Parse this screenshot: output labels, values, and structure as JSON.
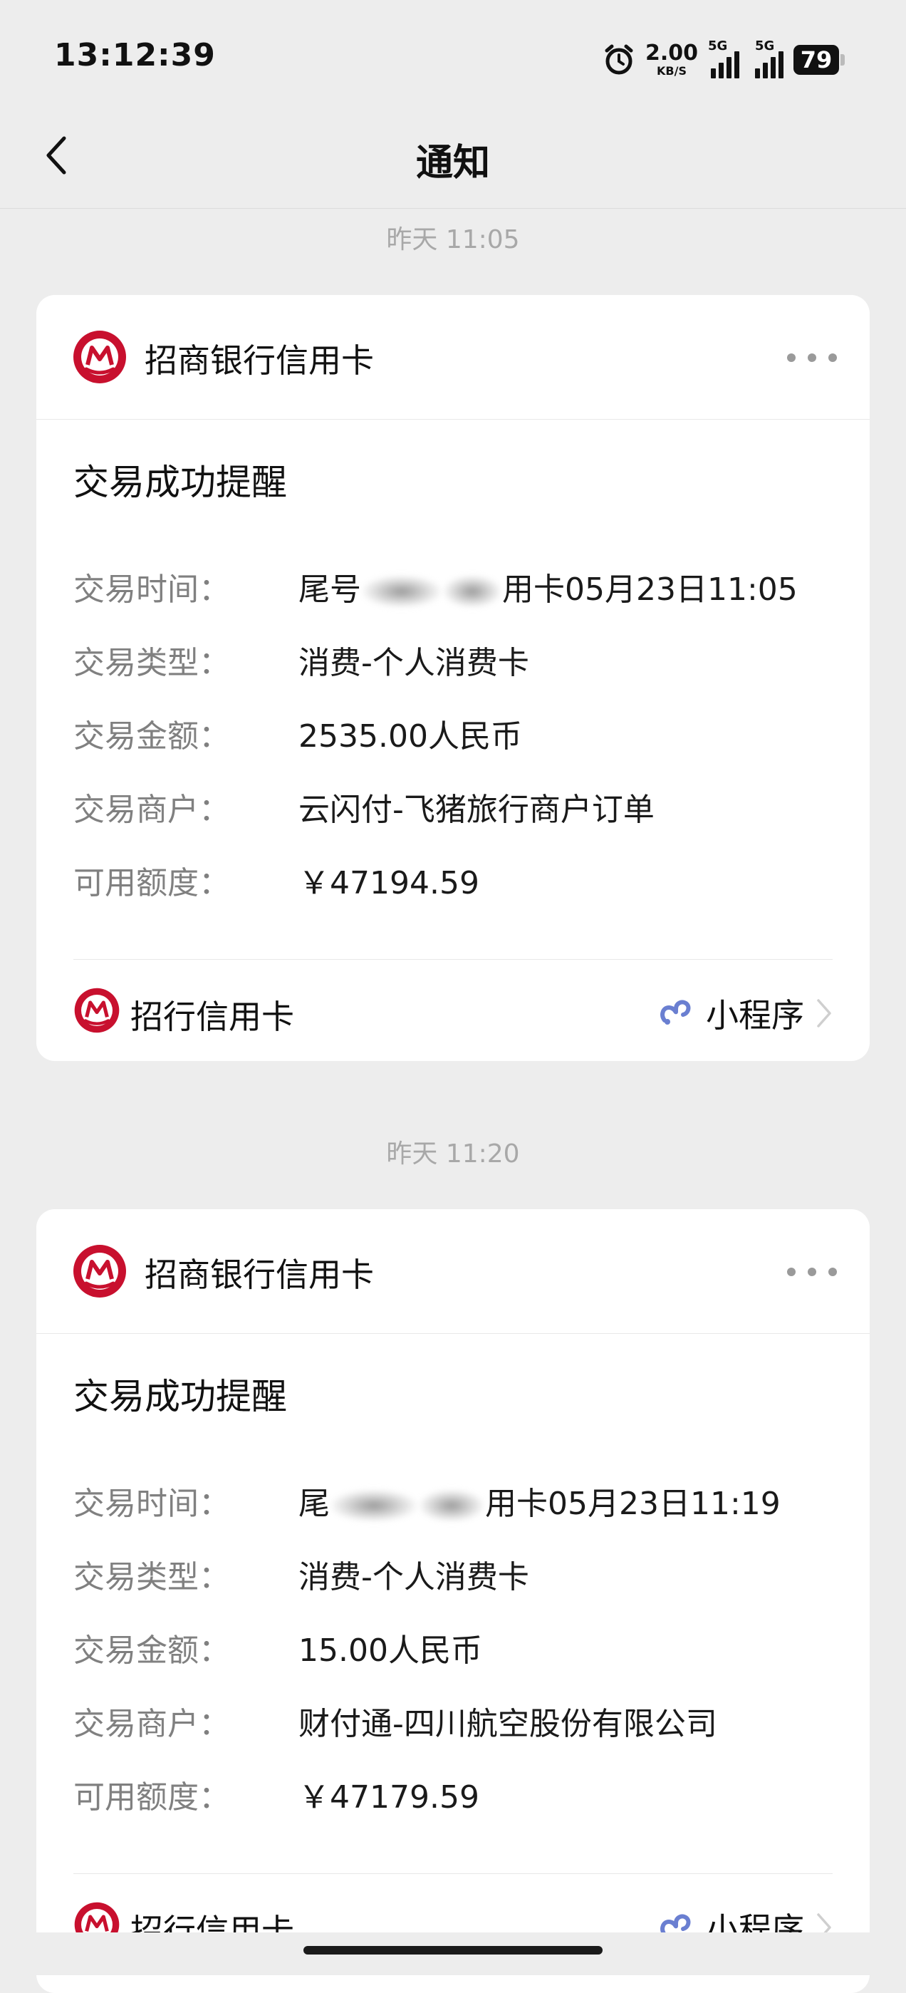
{
  "status_bar": {
    "time": "13:12:39",
    "net_speed_value": "2.00",
    "net_speed_unit": "KB/S",
    "signal1_tag": "5G",
    "signal2_tag": "5G",
    "battery": "79"
  },
  "nav": {
    "title": "通知"
  },
  "messages": [
    {
      "timestamp": "昨天 11:05",
      "sender": "招商银行信用卡",
      "title": "交易成功提醒",
      "details": [
        {
          "label": "交易时间：",
          "value_prefix": "尾号",
          "value_suffix": "用卡05月23日11:05"
        },
        {
          "label": "交易类型：",
          "value": "消费-个人消费卡"
        },
        {
          "label": "交易金额：",
          "value": "2535.00人民币"
        },
        {
          "label": "交易商户：",
          "value": "云闪付-飞猪旅行商户订单"
        },
        {
          "label": "可用额度：",
          "value": "￥47194.59"
        }
      ],
      "footer_name": "招行信用卡",
      "footer_link": "小程序"
    },
    {
      "timestamp": "昨天 11:20",
      "sender": "招商银行信用卡",
      "title": "交易成功提醒",
      "details": [
        {
          "label": "交易时间：",
          "value_prefix": "尾",
          "value_suffix": "用卡05月23日11:19"
        },
        {
          "label": "交易类型：",
          "value": "消费-个人消费卡"
        },
        {
          "label": "交易金额：",
          "value": "15.00人民币"
        },
        {
          "label": "交易商户：",
          "value": "财付通-四川航空股份有限公司"
        },
        {
          "label": "可用额度：",
          "value": "￥47179.59"
        }
      ],
      "footer_name": "招行信用卡",
      "footer_link": "小程序"
    }
  ],
  "icons": {
    "back": "chevron-left-icon",
    "more": "more-dots-icon",
    "sender_logo": "cmb-logo-icon",
    "mini_program": "mini-program-icon",
    "chevron": "chevron-right-icon",
    "alarm": "alarm-icon"
  },
  "colors": {
    "brand_red": "#c8102e",
    "background": "#ededed",
    "card": "#ffffff",
    "label_gray": "#808080",
    "timestamp_gray": "#a8a8a8",
    "mini_program_blue": "#6a7fd1"
  }
}
